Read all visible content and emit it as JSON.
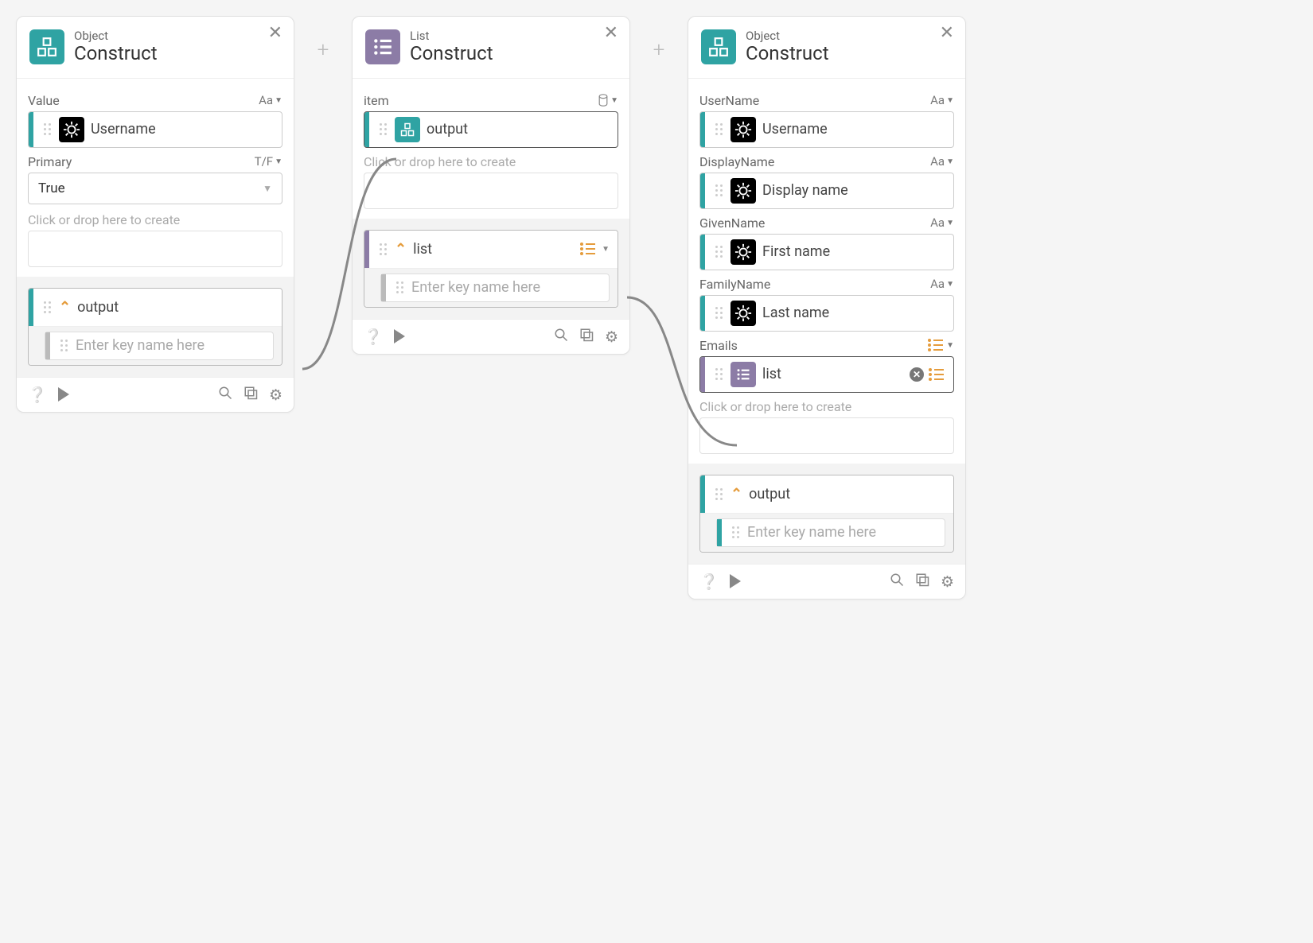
{
  "cards": [
    {
      "type_label": "Object",
      "title": "Construct",
      "icon": "object",
      "fields": [
        {
          "label": "Value",
          "type_badge": "Aa",
          "pill": {
            "icon": "spinner",
            "text": "Username",
            "sidebar": "teal"
          }
        },
        {
          "label": "Primary",
          "type_badge": "T/F",
          "select_value": "True"
        }
      ],
      "drop_hint": "Click or drop here to create",
      "output": {
        "label": "output",
        "sidebar": "teal",
        "placeholder": "Enter key name here"
      }
    },
    {
      "type_label": "List",
      "title": "Construct",
      "icon": "list",
      "fields": [
        {
          "label": "item",
          "type_badge": "db",
          "pill": {
            "icon": "object-small",
            "text": "output",
            "sidebar": "teal",
            "dark": true
          }
        }
      ],
      "drop_hint": "Click or drop here to create",
      "output": {
        "label": "list",
        "sidebar": "purple",
        "placeholder": "Enter key name here",
        "trailing": "list-orange"
      }
    },
    {
      "type_label": "Object",
      "title": "Construct",
      "icon": "object",
      "fields": [
        {
          "label": "UserName",
          "type_badge": "Aa",
          "pill": {
            "icon": "spinner",
            "text": "Username",
            "sidebar": "teal"
          }
        },
        {
          "label": "DisplayName",
          "type_badge": "Aa",
          "pill": {
            "icon": "spinner",
            "text": "Display name",
            "sidebar": "teal"
          }
        },
        {
          "label": "GivenName",
          "type_badge": "Aa",
          "pill": {
            "icon": "spinner",
            "text": "First name",
            "sidebar": "teal"
          }
        },
        {
          "label": "FamilyName",
          "type_badge": "Aa",
          "pill": {
            "icon": "spinner",
            "text": "Last name",
            "sidebar": "teal"
          }
        },
        {
          "label": "Emails",
          "type_badge": "list-orange",
          "pill": {
            "icon": "list-small",
            "text": "list",
            "sidebar": "purple",
            "dark": true,
            "trailing_close": true
          }
        }
      ],
      "drop_hint": "Click or drop here to create",
      "output": {
        "label": "output",
        "sidebar": "teal",
        "placeholder": "Enter key name here"
      }
    }
  ]
}
